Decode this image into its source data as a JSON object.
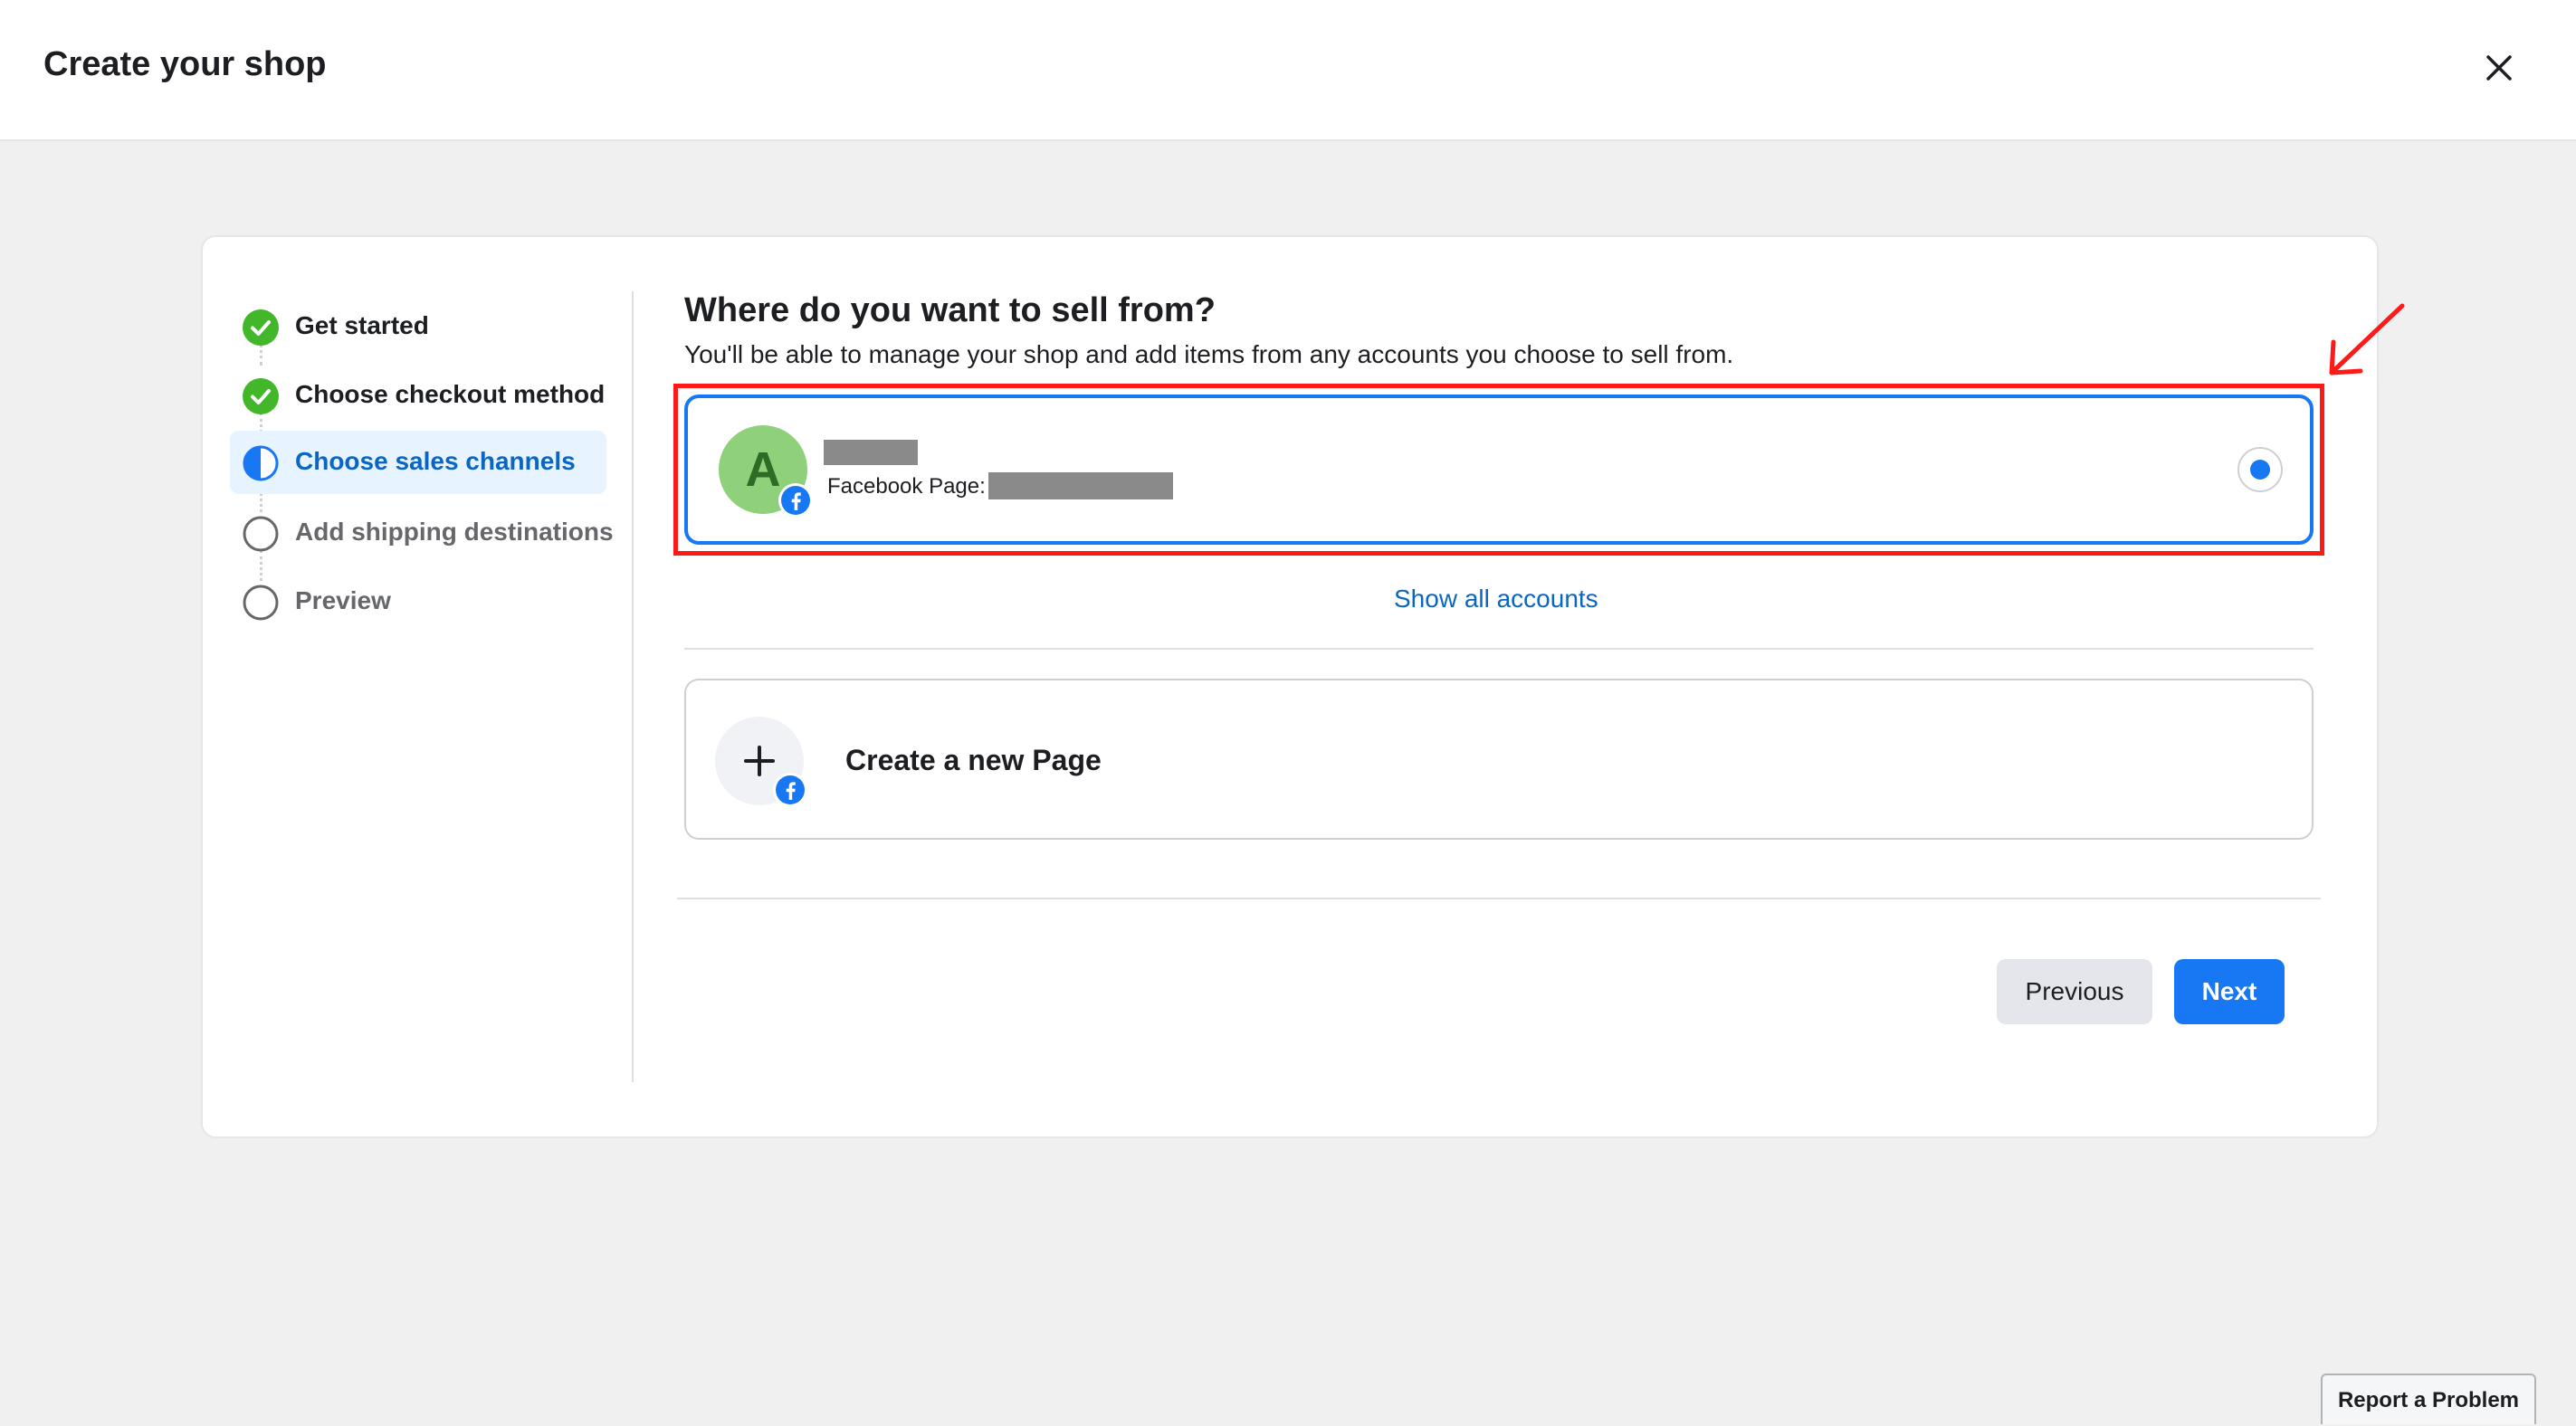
{
  "header": {
    "title": "Create your shop",
    "close_icon": "close-icon"
  },
  "steps": [
    {
      "label": "Get started",
      "status": "done",
      "icon": "check-circle-icon"
    },
    {
      "label": "Choose checkout method",
      "status": "done",
      "icon": "check-circle-icon"
    },
    {
      "label": "Choose sales channels",
      "status": "active",
      "icon": "half-circle-icon"
    },
    {
      "label": "Add shipping destinations",
      "status": "todo",
      "icon": "empty-circle-icon"
    },
    {
      "label": "Preview",
      "status": "todo",
      "icon": "empty-circle-icon"
    }
  ],
  "main": {
    "heading": "Where do you want to sell from?",
    "subheading": "You'll be able to manage your shop and add items from any accounts you choose to sell from.",
    "account": {
      "avatar_letter": "A",
      "sub_label": "Facebook Page:",
      "selected": true
    },
    "show_all_label": "Show all accounts",
    "new_page_label": "Create a new Page"
  },
  "footer": {
    "previous_label": "Previous",
    "next_label": "Next"
  },
  "report_label": "Report a Problem",
  "colors": {
    "accent": "#1877f2",
    "link": "#0a66c2",
    "success": "#42b72a",
    "highlight": "#ff1a1a",
    "avatar_bg": "#8fd07a"
  }
}
